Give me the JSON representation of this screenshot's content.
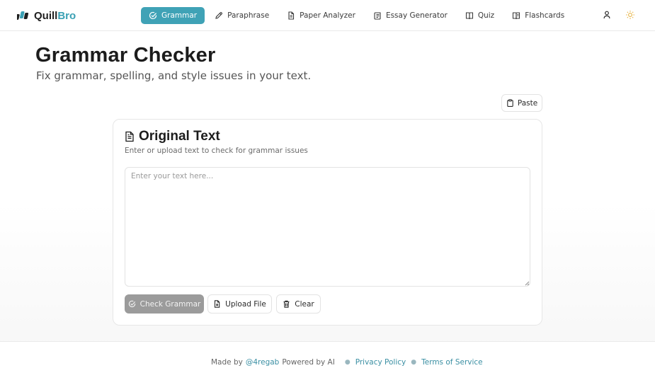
{
  "brand": {
    "prefix": "Quill",
    "suffix": "Bro",
    "accent_color": "#3aa0b4"
  },
  "nav": [
    {
      "label": "Grammar",
      "icon": "check-circle-icon",
      "active": true
    },
    {
      "label": "Paraphrase",
      "icon": "pencil-icon",
      "active": false
    },
    {
      "label": "Paper Analyzer",
      "icon": "document-icon",
      "active": false
    },
    {
      "label": "Essay Generator",
      "icon": "scroll-icon",
      "active": false
    },
    {
      "label": "Quiz",
      "icon": "book-icon",
      "active": false
    },
    {
      "label": "Flashcards",
      "icon": "book-open-icon",
      "active": false
    }
  ],
  "header_actions": {
    "user_icon": "user-icon",
    "theme_icon": "sun-icon"
  },
  "page": {
    "title": "Grammar Checker",
    "subtitle": "Fix grammar, spelling, and style issues in your text."
  },
  "paste_button": {
    "label": "Paste",
    "icon": "clipboard-icon"
  },
  "card": {
    "title": "Original Text",
    "description": "Enter or upload text to check for grammar issues",
    "input_value": "",
    "input_placeholder": "Enter your text here..."
  },
  "actions": {
    "check_label": "Check Grammar",
    "upload_label": "Upload File",
    "clear_label": "Clear"
  },
  "footer": {
    "made_by": "Made by",
    "author": "@4regab",
    "powered": "Powered by AI",
    "privacy": "Privacy Policy",
    "terms": "Terms of Service"
  },
  "colors": {
    "primary": "#3fa2b6",
    "disabled_button": "#9b9b9b",
    "link": "#3a8fa3"
  }
}
